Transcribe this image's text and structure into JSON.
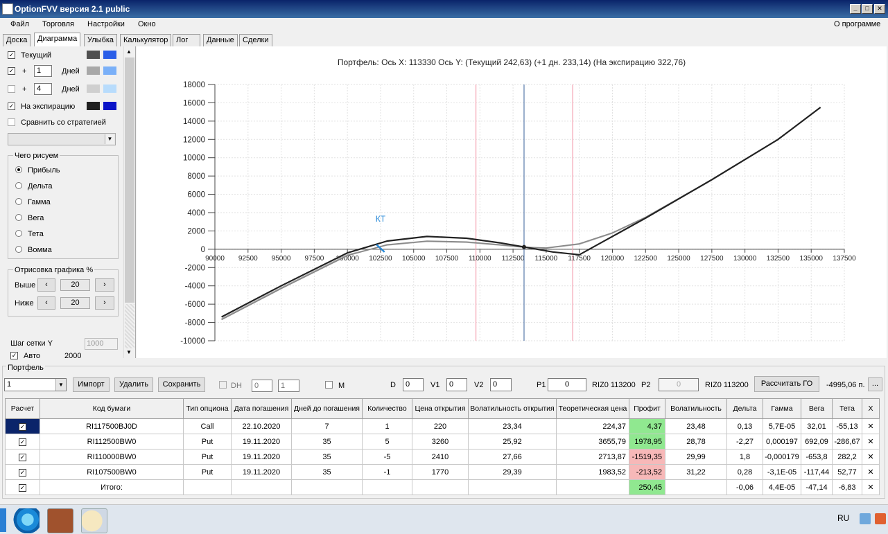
{
  "window": {
    "title": "OptionFVV версия 2.1 public"
  },
  "menu": {
    "items": [
      "Файл",
      "Торговля",
      "Настройки",
      "Окно"
    ],
    "about": "О программе"
  },
  "tabs": [
    "Доска",
    "Диаграмма",
    "Улыбка",
    "Калькулятор",
    "Лог",
    "Данные",
    "Сделки"
  ],
  "left": {
    "current_label": "Текущий",
    "plus1_days_value": "1",
    "plus4_days_value": "4",
    "plus_sign": "+",
    "days_label": "Дней",
    "expiration_label": "На экспирацию",
    "compare_label": "Сравнить со стратегией",
    "draw_group_title": "Чего рисуем",
    "radios": [
      "Прибыль",
      "Дельта",
      "Гамма",
      "Вега",
      "Тета",
      "Вомма"
    ],
    "render_group_title": "Отрисовка графика %",
    "above_label": "Выше",
    "below_label": "Ниже",
    "above_value": "20",
    "below_value": "20",
    "grid_step_label": "Шаг сетки Y",
    "grid_step_value": "1000",
    "auto_label": "Авто",
    "auto_value": "2000"
  },
  "chart_data": {
    "type": "line",
    "header": "Портфель: Ось X: 113330 Ось Y:  (Текущий 242,63)  (+1 дн. 233,14)  (На экспирацию 322,76)",
    "annotation": "КТ",
    "xlim": [
      90000,
      137500
    ],
    "ylim": [
      -10000,
      18000
    ],
    "x_ticks": [
      90000,
      92500,
      95000,
      97500,
      100000,
      102500,
      105000,
      107500,
      110000,
      112500,
      115000,
      117500,
      120000,
      122500,
      125000,
      127500,
      130000,
      132500,
      135000,
      137500
    ],
    "y_ticks": [
      18000,
      16000,
      14000,
      12000,
      10000,
      8000,
      6000,
      4000,
      2000,
      0,
      -2000,
      -4000,
      -6000,
      -8000,
      -10000
    ],
    "vlines": [
      {
        "x": 109700,
        "color": "#f4a0b0"
      },
      {
        "x": 113330,
        "color": "#5577aa"
      },
      {
        "x": 117000,
        "color": "#f4a0b0"
      }
    ],
    "point": {
      "x": 113330,
      "y": 243
    },
    "series": [
      {
        "color": "#222222",
        "x": [
          90500,
          95000,
          100000,
          103000,
          106000,
          109000,
          111500,
          113330,
          115500,
          117500,
          122500,
          127500,
          132500,
          135700
        ],
        "y": [
          -7400,
          -4000,
          -400,
          900,
          1400,
          1200,
          700,
          243,
          -300,
          -600,
          3400,
          7600,
          12000,
          15500
        ]
      },
      {
        "color": "#888888",
        "x": [
          90500,
          95000,
          100000,
          103000,
          106000,
          109000,
          111500,
          113330,
          115000,
          117500,
          120000,
          122500,
          127500,
          132500,
          135700
        ],
        "y": [
          -7700,
          -4300,
          -700,
          500,
          900,
          800,
          500,
          233,
          150,
          600,
          1800,
          3500,
          7600,
          12000,
          15500
        ]
      },
      {
        "color": "#aaaaaa",
        "x": [
          90500,
          95000,
          100000,
          103000,
          106000,
          109000,
          111500,
          113330,
          115000,
          117500,
          120000,
          122500,
          127500,
          132500,
          135700
        ],
        "y": [
          -7600,
          -4200,
          -600,
          450,
          850,
          750,
          450,
          210,
          120,
          550,
          1750,
          3450,
          7550,
          12000,
          15500
        ]
      }
    ]
  },
  "portfolio": {
    "title": "Портфель",
    "select_value": "1",
    "import_label": "Импорт",
    "delete_label": "Удалить",
    "save_label": "Сохранить",
    "dh_label": "DH",
    "spin1": "0",
    "spin2": "1",
    "m_label": "M",
    "d_label": "D",
    "d_value": "0",
    "v1_label": "V1",
    "v1_value": "0",
    "v2_label": "V2",
    "v2_value": "0",
    "p1_label": "P1",
    "p1_value": "0",
    "riz1": "RIZ0 113200",
    "p2_label": "P2",
    "p2_value": "0",
    "riz2": "RIZ0 113200",
    "calc_label": "Рассчитать ГО",
    "go_value": "-4995,06 п.",
    "dots_label": "..."
  },
  "table": {
    "headers": [
      "Расчет",
      "Код бумаги",
      "Тип опциона",
      "Дата погашения",
      "Дней до погашения",
      "Количество",
      "Цена открытия",
      "Волатильность открытия",
      "Теоретическая цена",
      "Профит",
      "Волатильность",
      "Дельта",
      "Гамма",
      "Вега",
      "Тета",
      "X"
    ],
    "rows": [
      {
        "code": "RI117500BJ0D",
        "type": "Call",
        "date": "22.10.2020",
        "days": "7",
        "qty": "1",
        "price": "220",
        "vol_open": "23,34",
        "theo": "224,37",
        "profit": "4,37",
        "profit_color": "#90e890",
        "vol": "23,48",
        "delta": "0,13",
        "gamma": "5,7E-05",
        "vega": "32,01",
        "theta": "-55,13"
      },
      {
        "code": "RI112500BW0",
        "type": "Put",
        "date": "19.11.2020",
        "days": "35",
        "qty": "5",
        "price": "3260",
        "vol_open": "25,92",
        "theo": "3655,79",
        "profit": "1978,95",
        "profit_color": "#90e890",
        "vol": "28,78",
        "delta": "-2,27",
        "gamma": "0,000197",
        "vega": "692,09",
        "theta": "-286,67"
      },
      {
        "code": "RI110000BW0",
        "type": "Put",
        "date": "19.11.2020",
        "days": "35",
        "qty": "-5",
        "price": "2410",
        "vol_open": "27,66",
        "theo": "2713,87",
        "profit": "-1519,35",
        "profit_color": "#f7b8b8",
        "vol": "29,99",
        "delta": "1,8",
        "gamma": "-0,000179",
        "vega": "-653,8",
        "theta": "282,2"
      },
      {
        "code": "RI107500BW0",
        "type": "Put",
        "date": "19.11.2020",
        "days": "35",
        "qty": "-1",
        "price": "1770",
        "vol_open": "29,39",
        "theo": "1983,52",
        "profit": "-213,52",
        "profit_color": "#f7b8b8",
        "vol": "31,22",
        "delta": "0,28",
        "gamma": "-3,1E-05",
        "vega": "-117,44",
        "theta": "52,77"
      }
    ],
    "total": {
      "label": "Итого:",
      "profit": "250,45",
      "delta": "-0,06",
      "gamma": "4,4E-05",
      "vega": "-47,14",
      "theta": "-6,83"
    }
  },
  "taskbar": {
    "lang": "RU"
  }
}
